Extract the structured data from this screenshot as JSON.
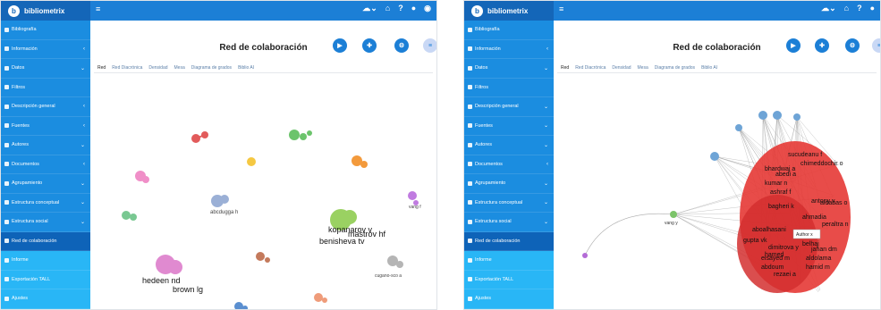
{
  "app": {
    "brand": "bibliometrix",
    "menu_icon": "hamburger-icon",
    "top_icons": [
      "cloud-icon",
      "home-icon",
      "help-icon",
      "github-icon",
      "r-icon"
    ],
    "help_label": "?"
  },
  "left_panel": {
    "sidebar": [
      {
        "label": "Bibliografía",
        "chev": ""
      },
      {
        "label": "Información",
        "chev": "‹"
      },
      {
        "label": "Datos",
        "chev": "⌄"
      },
      {
        "label": "Filtros",
        "chev": ""
      },
      {
        "label": "Descripción general",
        "chev": "‹"
      },
      {
        "label": "Fuentes",
        "chev": "‹"
      },
      {
        "label": "Autores",
        "chev": "⌄"
      },
      {
        "label": "Documentos",
        "chev": "‹"
      },
      {
        "label": "Agrupamiento",
        "chev": "⌄"
      },
      {
        "label": "Estructura conceptual",
        "chev": "⌄"
      },
      {
        "label": "Estructura social",
        "chev": "⌄"
      },
      {
        "label": "Red de colaboración",
        "chev": ""
      },
      {
        "label": "Informe",
        "chev": ""
      },
      {
        "label": "Exportación TALL",
        "chev": ""
      },
      {
        "label": "Ajustes",
        "chev": ""
      }
    ],
    "title": "Red de colaboración",
    "tabs": [
      "Red",
      "Red Diacrónica",
      "Densidad",
      "Mesa",
      "Diagrama de grados",
      "Biblio AI"
    ],
    "nodes_labels": [
      "hedeen nd",
      "brown lg",
      "kopanarov v",
      "mastrov hf",
      "benisheva tv",
      "abcdugga h",
      "vang f",
      "cugano-sco a"
    ]
  },
  "right_panel": {
    "sidebar": [
      {
        "label": "Bibliografía",
        "chev": ""
      },
      {
        "label": "Información",
        "chev": "‹"
      },
      {
        "label": "Datos",
        "chev": "⌄"
      },
      {
        "label": "Filtros",
        "chev": ""
      },
      {
        "label": "Descripción general",
        "chev": "⌄"
      },
      {
        "label": "Fuentes",
        "chev": "⌄"
      },
      {
        "label": "Autores",
        "chev": "⌄"
      },
      {
        "label": "Documentos",
        "chev": "‹"
      },
      {
        "label": "Agrupamiento",
        "chev": "⌄"
      },
      {
        "label": "Estructura conceptual",
        "chev": "⌄"
      },
      {
        "label": "Estructura social",
        "chev": "⌄"
      },
      {
        "label": "Red de colaboración",
        "chev": ""
      },
      {
        "label": "Informe",
        "chev": ""
      },
      {
        "label": "Exportación TALL",
        "chev": ""
      },
      {
        "label": "Ajustes",
        "chev": ""
      }
    ],
    "title": "Red de colaboración",
    "tabs": [
      "Red",
      "Red Diacrónica",
      "Densidad",
      "Mesa",
      "Diagrama de grados",
      "Biblio AI"
    ],
    "nodes_labels": [
      "sucudeanu f",
      "chimeddochir o",
      "bhardwaj a",
      "abedi a",
      "kumar n",
      "ashraf f",
      "antony v",
      "aldabas o",
      "bagheri k",
      "ahmadia",
      "aboalhasani",
      "peraltra n",
      "gupta vk",
      "dimitrova y",
      "belhaj",
      "hamed",
      "jahan dm",
      "elsayed m",
      "aldolama",
      "abdoum",
      "hamid m",
      "vang y",
      "rezaei a"
    ],
    "tooltip": "Author x"
  },
  "colors": {
    "topbar": "#1c7fd6",
    "sidebar": "#1b8de0",
    "active": "#0e63b8",
    "fab_blue": "#1c7fd6",
    "fab_light": "#c9d8f5",
    "red_cluster": "#e53935",
    "blue_cluster": "#6ea4d6"
  }
}
